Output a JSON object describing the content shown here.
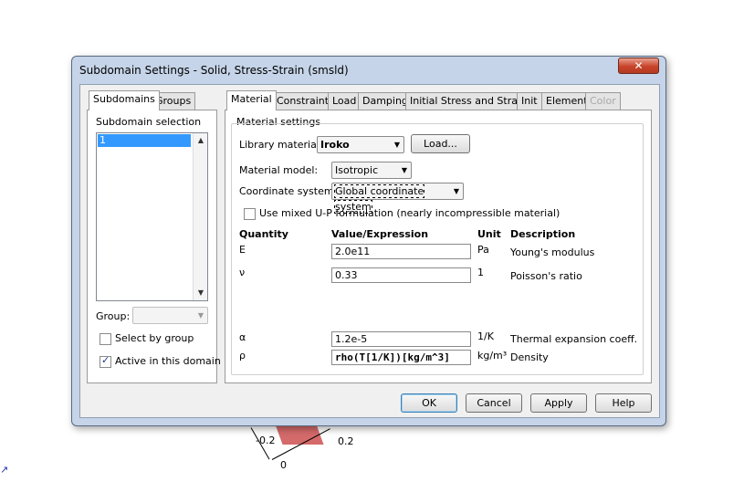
{
  "background": {
    "axis_labels": [
      "-0.2",
      "0.2",
      "0"
    ]
  },
  "dialog": {
    "title": "Subdomain Settings - Solid, Stress-Strain (smsld)",
    "close_glyph": "✕",
    "left_panel": {
      "tabs": [
        {
          "label": "Subdomains",
          "active": true
        },
        {
          "label": "Groups",
          "active": false
        }
      ],
      "selection_label": "Subdomain selection",
      "list_items": [
        "1"
      ],
      "group_label": "Group:",
      "group_value": "",
      "select_by_group_label": "Select by group",
      "select_by_group_checked": false,
      "active_domain_label": "Active in this domain",
      "active_domain_checked": true
    },
    "right_panel": {
      "tabs": [
        {
          "label": "Material",
          "state": "active"
        },
        {
          "label": "Constraint",
          "state": "inactive"
        },
        {
          "label": "Load",
          "state": "inactive"
        },
        {
          "label": "Damping",
          "state": "inactive"
        },
        {
          "label": "Initial Stress and Strain",
          "state": "inactive"
        },
        {
          "label": "Init",
          "state": "inactive"
        },
        {
          "label": "Element",
          "state": "inactive"
        },
        {
          "label": "Color",
          "state": "disabled"
        }
      ],
      "section_title": "Material settings",
      "library_material_label": "Library material:",
      "library_material_value": "Iroko",
      "load_button": "Load...",
      "material_model_label": "Material model:",
      "material_model_value": "Isotropic",
      "coordinate_system_label": "Coordinate system:",
      "coordinate_system_value": "Global coordinate system",
      "mixed_up_label": "Use mixed U-P formulation (nearly incompressible material)",
      "mixed_up_checked": false,
      "columns": {
        "quantity": "Quantity",
        "value": "Value/Expression",
        "unit": "Unit",
        "description": "Description"
      },
      "rows": [
        {
          "quantity": "E",
          "value": "2.0e11",
          "unit": "Pa",
          "description": "Young's modulus"
        },
        {
          "quantity": "ν",
          "value": "0.33",
          "unit": "1",
          "description": "Poisson's ratio"
        },
        {
          "quantity": "α",
          "value": "1.2e-5",
          "unit": "1/K",
          "description": "Thermal expansion coeff."
        },
        {
          "quantity": "ρ",
          "value": "rho(T[1/K])[kg/m^3]",
          "unit": "kg/m³",
          "description": "Density"
        }
      ]
    },
    "buttons": {
      "ok": "OK",
      "cancel": "Cancel",
      "apply": "Apply",
      "help": "Help"
    }
  }
}
